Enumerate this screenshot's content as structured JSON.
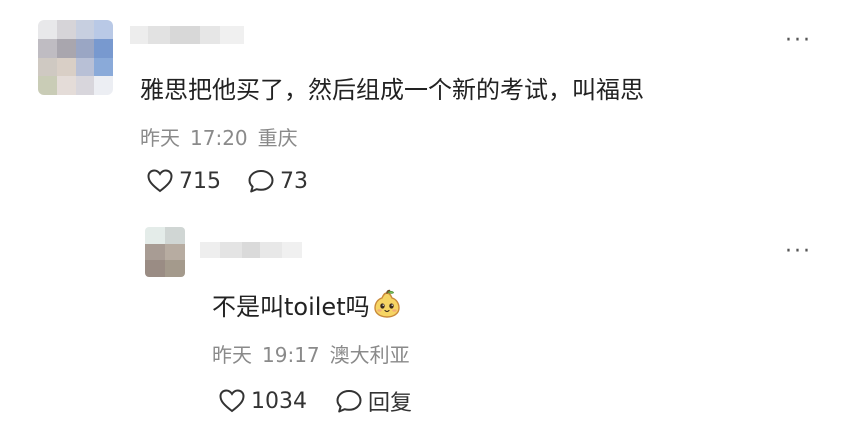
{
  "comments": [
    {
      "text": "雅思把他买了，然后组成一个新的考试，叫福思",
      "date": "昨天",
      "time": "17:20",
      "location": "重庆",
      "likes": "715",
      "replies": "73"
    }
  ],
  "reply": {
    "text": "不是叫toilet吗",
    "emoji": "pear-face-emoji",
    "date": "昨天",
    "time": "19:17",
    "location": "澳大利亚",
    "likes": "1034",
    "reply_label": "回复"
  },
  "icons": {
    "more": "more-icon",
    "like": "heart-icon",
    "comment": "comment-bubble-icon"
  }
}
